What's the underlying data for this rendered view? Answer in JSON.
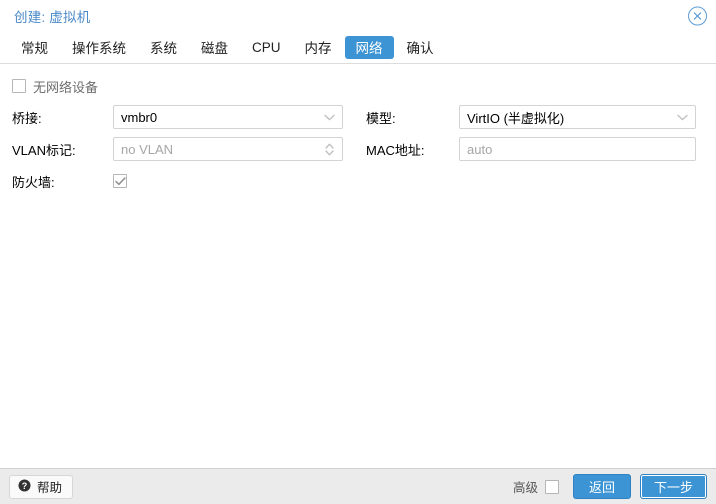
{
  "window": {
    "title": "创建: 虚拟机",
    "close_icon": "close-circle-icon",
    "accent_color": "#3c94d4",
    "title_color": "#4a89c8"
  },
  "tabs": [
    {
      "label": "常规",
      "active": false
    },
    {
      "label": "操作系统",
      "active": false
    },
    {
      "label": "系统",
      "active": false
    },
    {
      "label": "磁盘",
      "active": false
    },
    {
      "label": "CPU",
      "active": false
    },
    {
      "label": "内存",
      "active": false
    },
    {
      "label": "网络",
      "active": true
    },
    {
      "label": "确认",
      "active": false
    }
  ],
  "form": {
    "no_network_device": {
      "label": "无网络设备",
      "checked": false
    },
    "left": {
      "bridge": {
        "label": "桥接:",
        "value": "vmbr0",
        "is_placeholder": false,
        "trigger_icon": "chevron-down-icon"
      },
      "vlan_tag": {
        "label": "VLAN标记:",
        "value": "no VLAN",
        "is_placeholder": true,
        "trigger_icon": "spinner-updown-icon"
      },
      "firewall": {
        "label": "防火墙:",
        "checked": true
      }
    },
    "right": {
      "model": {
        "label": "模型:",
        "value": "VirtIO (半虚拟化)",
        "is_placeholder": false,
        "trigger_icon": "chevron-down-icon"
      },
      "mac_address": {
        "label": "MAC地址:",
        "value": "auto",
        "is_placeholder": true
      }
    }
  },
  "footer": {
    "help": {
      "label": "帮助",
      "icon": "question-circle-icon"
    },
    "advanced": {
      "label": "高级",
      "checked": false
    },
    "back_button": "返回",
    "next_button": "下一步"
  }
}
